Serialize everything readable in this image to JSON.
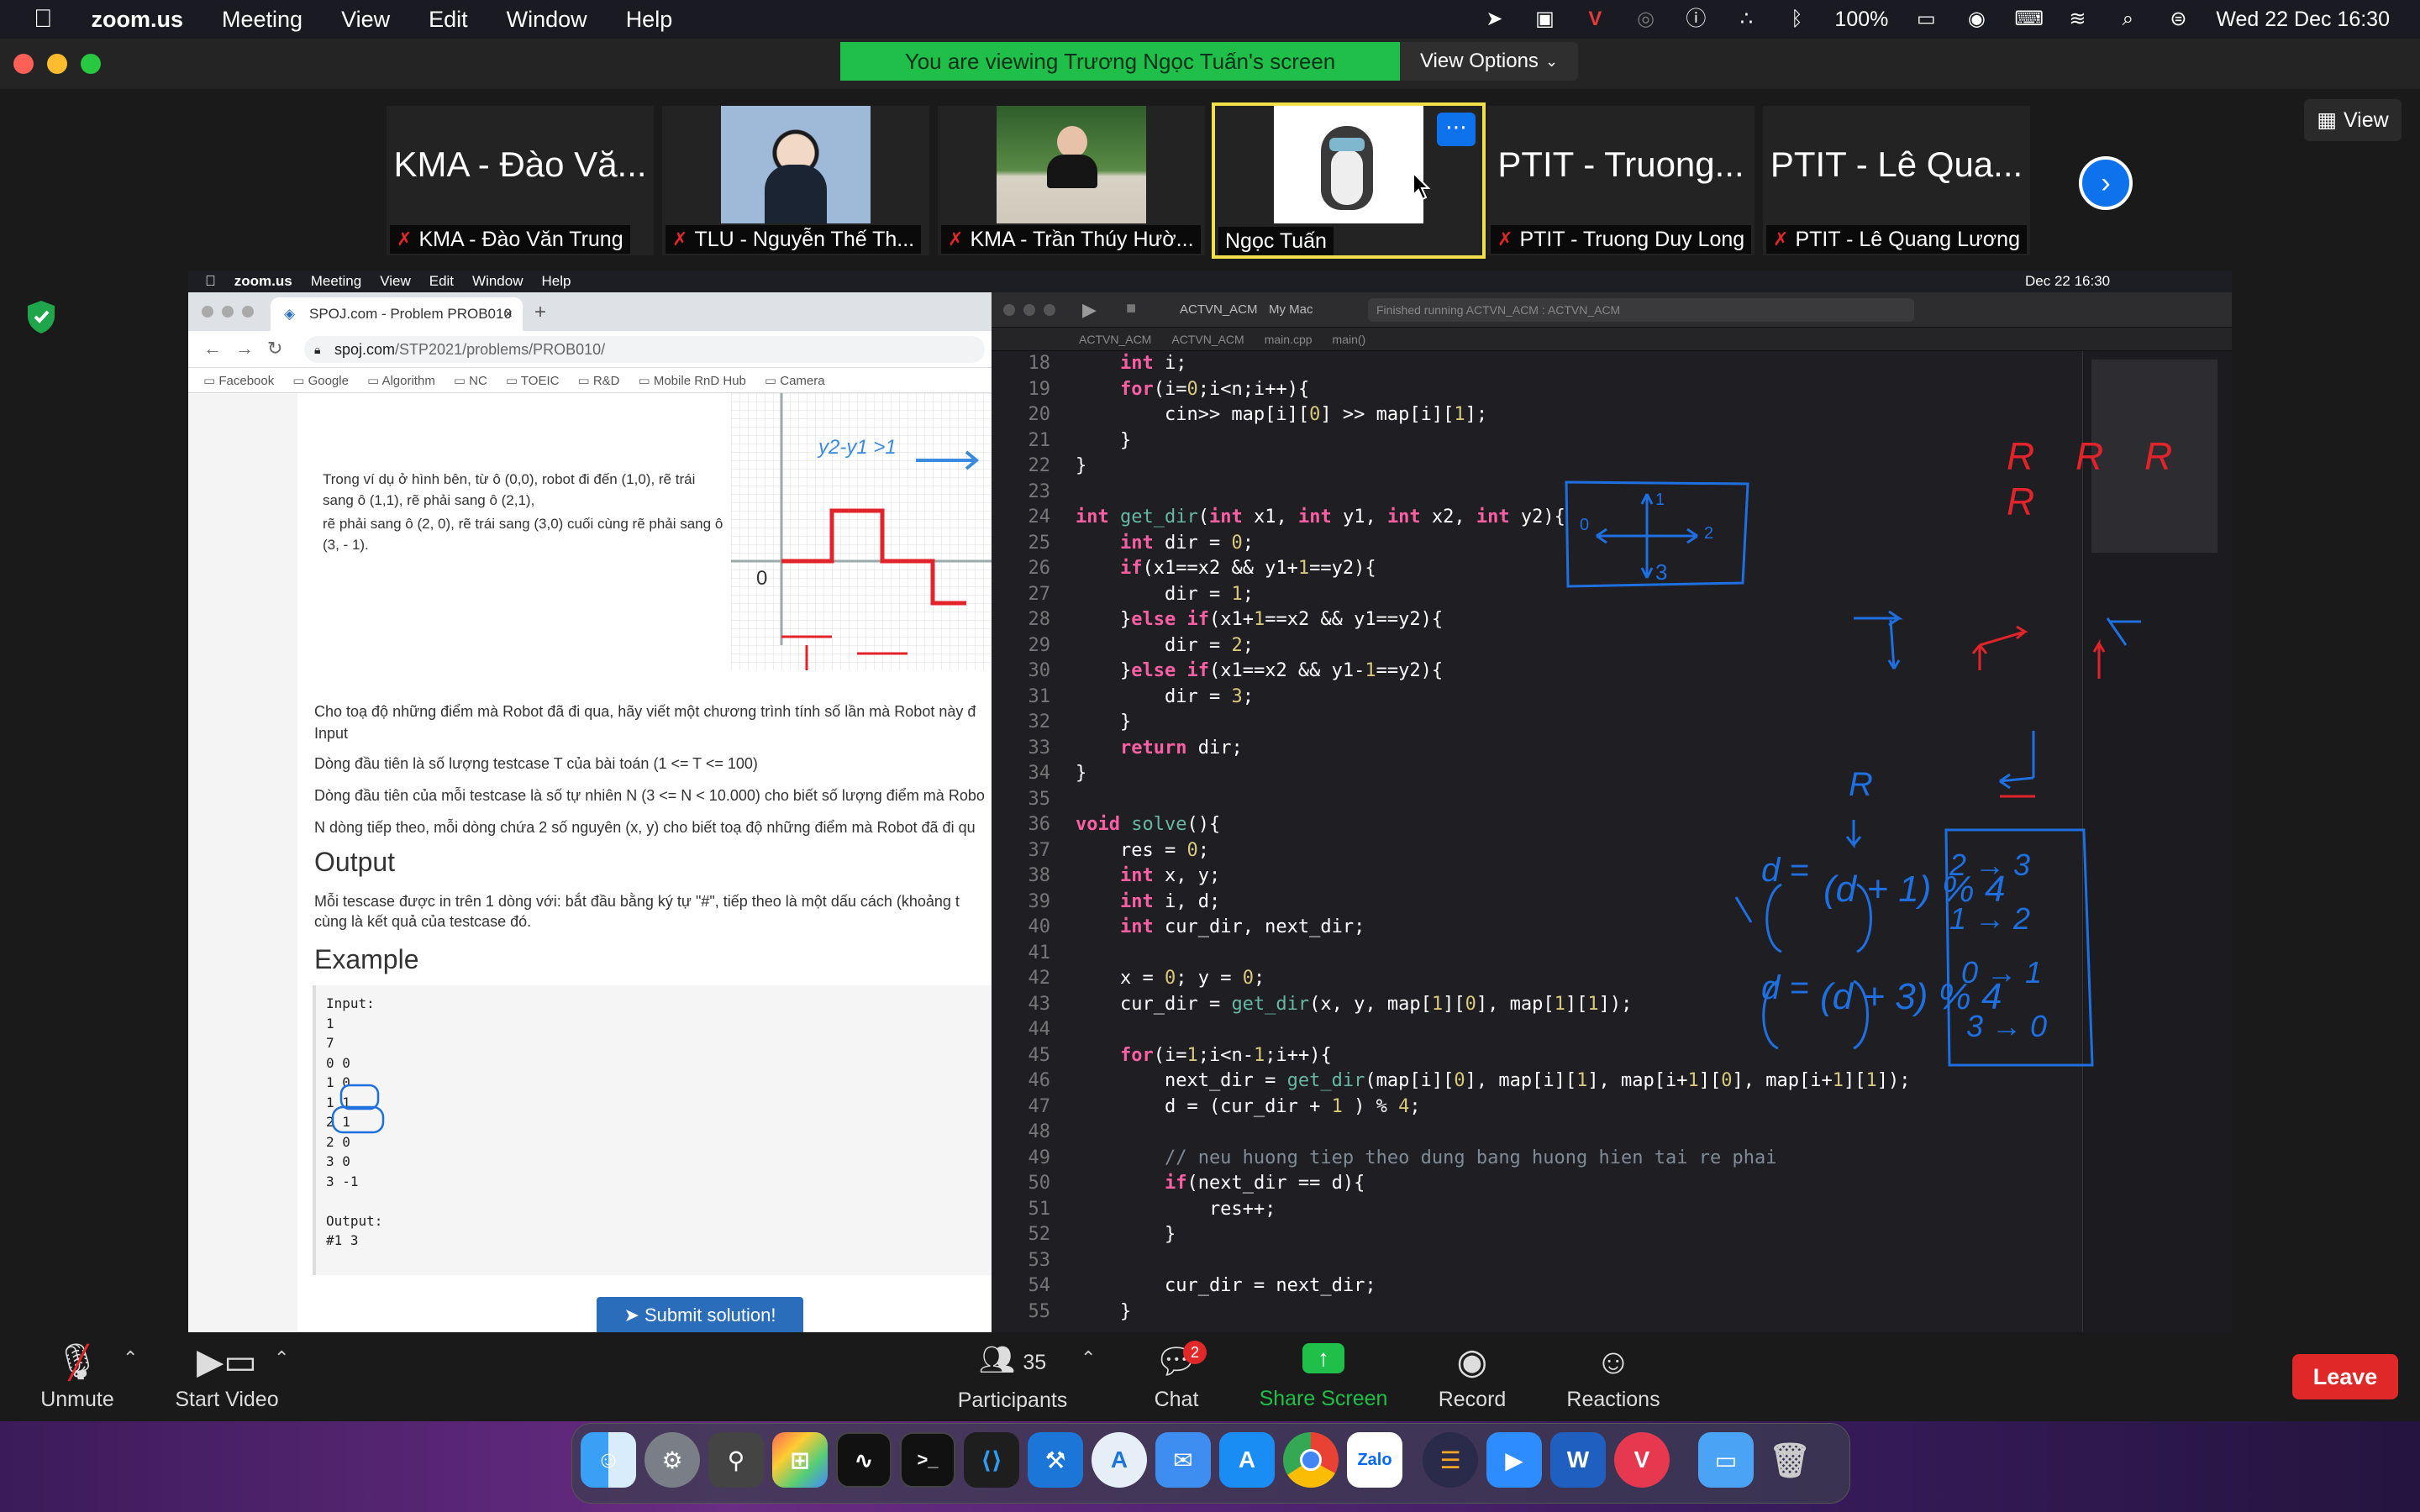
{
  "menubar": {
    "app": "zoom.us",
    "items": [
      "Meeting",
      "View",
      "Edit",
      "Window",
      "Help"
    ],
    "battery": "100%",
    "clock": "Wed 22 Dec  16:30"
  },
  "zoom": {
    "banner": "You are viewing Trương Ngọc Tuấn's screen",
    "view_options": "View Options",
    "view_button": "View",
    "tiles": [
      {
        "big": "KMA - Đào Vă...",
        "name": "KMA - Đào Văn Trung"
      },
      {
        "big": "",
        "name": "TLU - Nguyễn Thế Th..."
      },
      {
        "big": "",
        "name": "KMA - Trần Thúy Hườ..."
      },
      {
        "big": "",
        "name": "Ngọc Tuấn"
      },
      {
        "big": "PTIT - Truong...",
        "name": "PTIT - Truong Duy Long"
      },
      {
        "big": "PTIT - Lê Qua...",
        "name": "PTIT - Lê Quang Lương"
      }
    ],
    "toolbar": {
      "unmute": "Unmute",
      "start_video": "Start Video",
      "participants": "Participants",
      "participants_count": "35",
      "chat": "Chat",
      "chat_badge": "2",
      "share_screen": "Share Screen",
      "record": "Record",
      "reactions": "Reactions",
      "leave": "Leave"
    }
  },
  "shared": {
    "menubar": {
      "app": "zoom.us",
      "items": [
        "Meeting",
        "View",
        "Edit",
        "Window",
        "Help"
      ],
      "clock": "Dec 22  16:30"
    },
    "browser": {
      "tab": "SPOJ.com - Problem PROB010",
      "url_host": "spoj.com",
      "url_path": "/STP2021/problems/PROB010/",
      "bookmarks": [
        "Facebook",
        "Google",
        "Algorithm",
        "NC",
        "TOEIC",
        "R&D",
        "Mobile RnD Hub",
        "Camera"
      ],
      "p1": "Trong ví dụ ở hình bên, từ ô (0,0), robot đi đến (1,0), rẽ trái sang ô (1,1), rẽ phải sang ô (2,1),",
      "p2": "rẽ phải sang ô (2, 0), rẽ trái sang (3,0) cuối cùng rẽ phải sang ô (3, - 1).",
      "p3": "Cho toạ độ những điểm mà Robot đã đi qua, hãy viết một chương trình tính số lần mà Robot này đ",
      "input_label": "Input",
      "p4": "Dòng đầu tiên là số lượng testcase T của bài toán (1 <= T <= 100)",
      "p5": "Dòng đầu tiên của mỗi testcase là số tự nhiên N (3 <= N < 10.000) cho biết số lượng điểm mà Robo",
      "p6": "N dòng tiếp theo, mỗi dòng chứa 2 số nguyên (x, y) cho biết toạ độ những điểm mà Robot đã đi qu",
      "output_heading": "Output",
      "p7": "Mỗi tescase được in trên 1 dòng với: bắt đầu bằng ký tự \"#\", tiếp theo là một dấu cách (khoảng t",
      "p8": "cùng là kết quả của testcase đó.",
      "example_heading": "Example",
      "example": "Input:\n1\n7\n0 0\n1 0\n1 1\n2 1\n2 0\n3 0\n3 -1\n\nOutput:\n#1 3",
      "submit": "Submit solution!",
      "fig_label": "y2-y1 >1",
      "fig_zero": "0"
    },
    "xcode": {
      "scheme": "ACTVN_ACM",
      "device": "My Mac",
      "status": "Finished running ACTVN_ACM : ACTVN_ACM",
      "crumbs": [
        "ACTVN_ACM",
        "ACTVN_ACM",
        "main.cpp",
        "main()"
      ],
      "lines": [
        {
          "n": "18",
          "t": "    int i;"
        },
        {
          "n": "19",
          "t": "    for(i=0;i<n;i++){"
        },
        {
          "n": "20",
          "t": "        cin>> map[i][0] >> map[i][1];"
        },
        {
          "n": "21",
          "t": "    }"
        },
        {
          "n": "22",
          "t": "}"
        },
        {
          "n": "23",
          "t": ""
        },
        {
          "n": "24",
          "t": "int get_dir(int x1, int y1, int x2, int y2){"
        },
        {
          "n": "25",
          "t": "    int dir = 0;"
        },
        {
          "n": "26",
          "t": "    if(x1==x2 && y1+1==y2){"
        },
        {
          "n": "27",
          "t": "        dir = 1;"
        },
        {
          "n": "28",
          "t": "    }else if(x1+1==x2 && y1==y2){"
        },
        {
          "n": "29",
          "t": "        dir = 2;"
        },
        {
          "n": "30",
          "t": "    }else if(x1==x2 && y1-1==y2){"
        },
        {
          "n": "31",
          "t": "        dir = 3;"
        },
        {
          "n": "32",
          "t": "    }"
        },
        {
          "n": "33",
          "t": "    return dir;"
        },
        {
          "n": "34",
          "t": "}"
        },
        {
          "n": "35",
          "t": ""
        },
        {
          "n": "36",
          "t": "void solve(){"
        },
        {
          "n": "37",
          "t": "    res = 0;"
        },
        {
          "n": "38",
          "t": "    int x, y;"
        },
        {
          "n": "39",
          "t": "    int i, d;"
        },
        {
          "n": "40",
          "t": "    int cur_dir, next_dir;"
        },
        {
          "n": "41",
          "t": ""
        },
        {
          "n": "42",
          "t": "    x = 0; y = 0;"
        },
        {
          "n": "43",
          "t": "    cur_dir = get_dir(x, y, map[1][0], map[1][1]);"
        },
        {
          "n": "44",
          "t": ""
        },
        {
          "n": "45",
          "t": "    for(i=1;i<n-1;i++){"
        },
        {
          "n": "46",
          "t": "        next_dir = get_dir(map[i][0], map[i][1], map[i+1][0], map[i+1][1]);"
        },
        {
          "n": "47",
          "t": "        d = (cur_dir + 1 ) % 4;"
        },
        {
          "n": "48",
          "t": ""
        },
        {
          "n": "49",
          "t": "        // neu huong tiep theo dung bang huong hien tai re phai"
        },
        {
          "n": "50",
          "t": "        if(next_dir == d){"
        },
        {
          "n": "51",
          "t": "            res++;"
        },
        {
          "n": "52",
          "t": "        }"
        },
        {
          "n": "53",
          "t": ""
        },
        {
          "n": "54",
          "t": "        cur_dir = next_dir;"
        },
        {
          "n": "55",
          "t": "    }"
        }
      ],
      "annotations": {
        "rrrr": "R R R R",
        "formula1_l": "d =",
        "formula1": "(d + 1) % 4",
        "formula2_l": "d =",
        "formula2": "(d + 3) % 4",
        "r_label": "R",
        "map": [
          "2 → 3",
          "1 → 2",
          "0 → 1",
          "3 → 0"
        ],
        "box_nums": [
          "0",
          "1",
          "2",
          "3"
        ]
      }
    }
  },
  "colors": {
    "accent": "#0e72ed",
    "banner": "#1fbf4a",
    "leave": "#e02828",
    "ink_blue": "#1e6fe0",
    "ink_red": "#e0242a"
  }
}
